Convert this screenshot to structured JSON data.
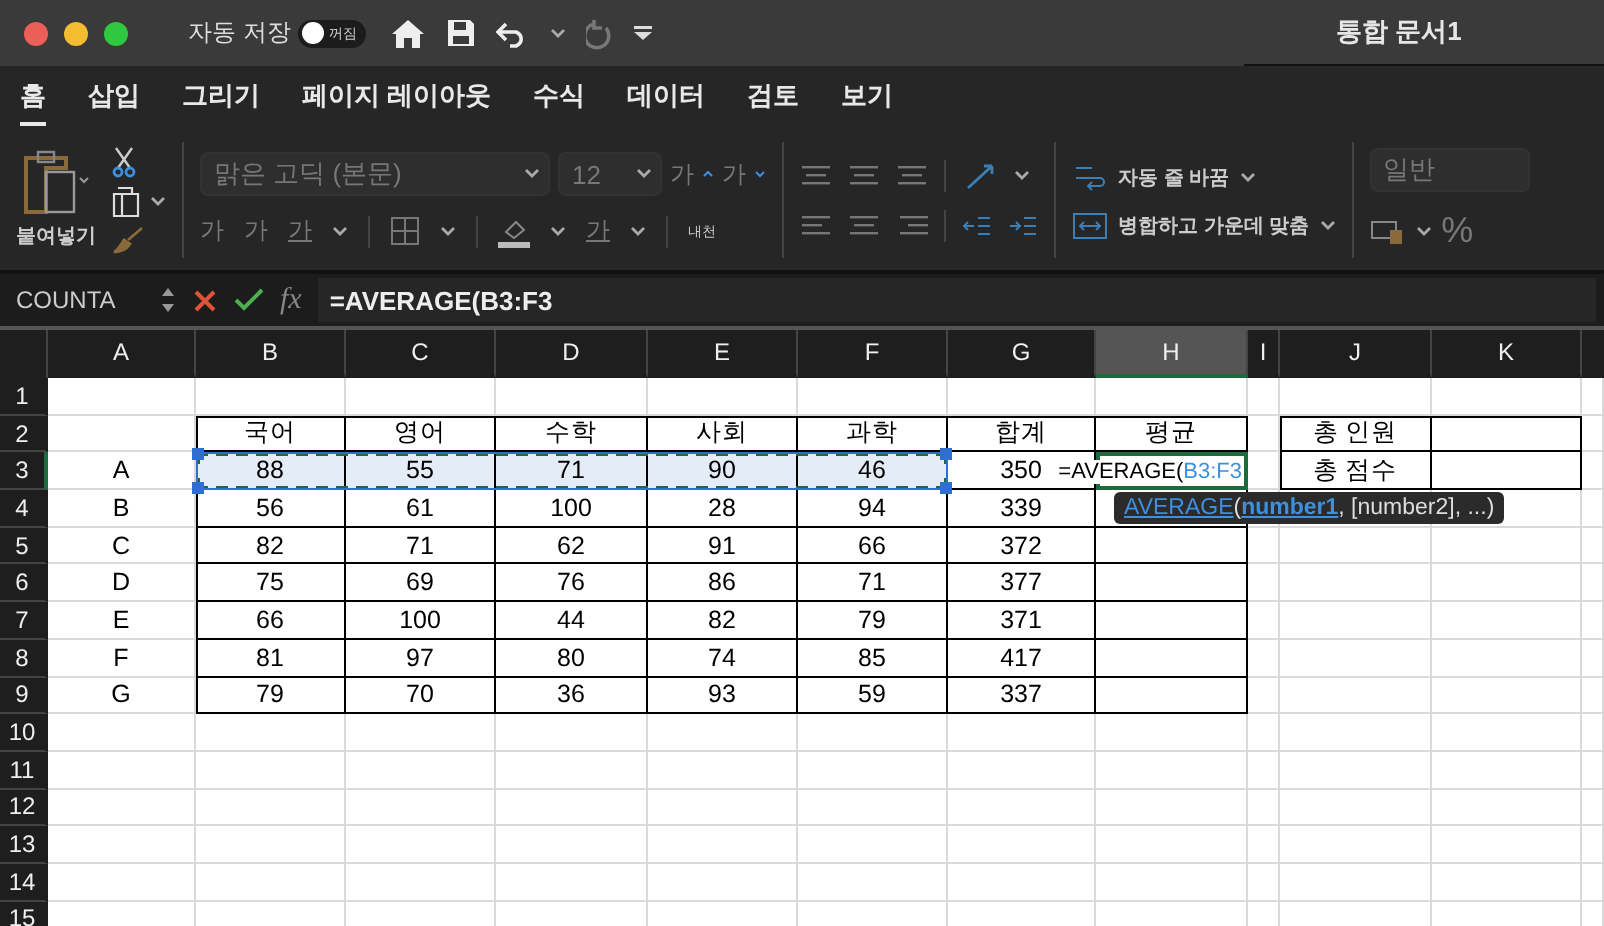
{
  "window": {
    "title": "통합 문서1"
  },
  "autosave": {
    "label": "자동 저장",
    "state_label": "꺼짐",
    "on": false
  },
  "tabs": [
    {
      "label": "홈",
      "selected": true
    },
    {
      "label": "삽입",
      "selected": false
    },
    {
      "label": "그리기",
      "selected": false
    },
    {
      "label": "페이지 레이아웃",
      "selected": false
    },
    {
      "label": "수식",
      "selected": false
    },
    {
      "label": "데이터",
      "selected": false
    },
    {
      "label": "검토",
      "selected": false
    },
    {
      "label": "보기",
      "selected": false
    }
  ],
  "ribbon": {
    "paste_label": "붙여넣기",
    "font_name": "맑은 고딕 (본문)",
    "font_size": "12",
    "grow_font": "가",
    "shrink_font": "가",
    "style_buttons": [
      "가",
      "가",
      "가"
    ],
    "font_color": "가",
    "phonetic": "내천",
    "wrap_text": "자동 줄 바꿈",
    "merge_center": "병합하고 가운데 맞춤",
    "number_format": "일반",
    "percent": "%"
  },
  "formula_bar": {
    "name_box": "COUNTA",
    "fx": "fx",
    "formula": "=AVERAGE(B3:F3"
  },
  "columns": [
    "A",
    "B",
    "C",
    "D",
    "E",
    "F",
    "G",
    "H",
    "I",
    "J",
    "K"
  ],
  "rows": [
    {
      "number": "1",
      "cells": [
        {
          "bordered": false
        },
        {
          "bordered": false
        },
        {
          "bordered": false
        },
        {
          "bordered": false
        },
        {
          "bordered": false
        },
        {
          "bordered": false
        },
        {
          "bordered": false
        },
        {
          "bordered": false
        },
        {
          "bordered": false
        },
        {
          "bordered": false
        },
        {
          "bordered": false
        }
      ]
    },
    {
      "number": "2",
      "cells": [
        {
          "bordered": false
        },
        {
          "text": "국어",
          "bordered": true
        },
        {
          "text": "영어",
          "bordered": true
        },
        {
          "text": "수학",
          "bordered": true
        },
        {
          "text": "사회",
          "bordered": true
        },
        {
          "text": "과학",
          "bordered": true
        },
        {
          "text": "합계",
          "bordered": true
        },
        {
          "text": "평균",
          "bordered": true
        },
        {
          "bordered": false
        },
        {
          "text": "총 인원",
          "bordered": true
        },
        {
          "bordered": true
        }
      ]
    },
    {
      "number": "3",
      "cells": [
        {
          "text": "A",
          "bordered": false
        },
        {
          "text": "88",
          "bordered": true,
          "copied": true
        },
        {
          "text": "55",
          "bordered": true,
          "copied": true
        },
        {
          "text": "71",
          "bordered": true,
          "copied": true
        },
        {
          "text": "90",
          "bordered": true,
          "copied": true
        },
        {
          "text": "46",
          "bordered": true,
          "copied": true
        },
        {
          "text": "350",
          "bordered": true
        },
        {
          "bordered": true,
          "active": true,
          "parts": [
            {
              "kind": "plain",
              "text": "=AVERAGE("
            },
            {
              "kind": "reference",
              "text": "B3:F3"
            }
          ]
        },
        {
          "bordered": false
        },
        {
          "text": "총 점수",
          "bordered": true
        },
        {
          "bordered": true
        }
      ]
    },
    {
      "number": "4",
      "cells": [
        {
          "text": "B",
          "bordered": false
        },
        {
          "text": "56",
          "bordered": true
        },
        {
          "text": "61",
          "bordered": true
        },
        {
          "text": "100",
          "bordered": true
        },
        {
          "text": "28",
          "bordered": true
        },
        {
          "text": "94",
          "bordered": true
        },
        {
          "text": "339",
          "bordered": true
        },
        {
          "bordered": true
        },
        {
          "bordered": false
        },
        {
          "bordered": false
        },
        {
          "bordered": false
        }
      ]
    },
    {
      "number": "5",
      "cells": [
        {
          "text": "C",
          "bordered": false
        },
        {
          "text": "82",
          "bordered": true
        },
        {
          "text": "71",
          "bordered": true
        },
        {
          "text": "62",
          "bordered": true
        },
        {
          "text": "91",
          "bordered": true
        },
        {
          "text": "66",
          "bordered": true
        },
        {
          "text": "372",
          "bordered": true
        },
        {
          "bordered": true
        },
        {
          "bordered": false
        },
        {
          "bordered": false
        },
        {
          "bordered": false
        }
      ]
    },
    {
      "number": "6",
      "cells": [
        {
          "text": "D",
          "bordered": false
        },
        {
          "text": "75",
          "bordered": true
        },
        {
          "text": "69",
          "bordered": true
        },
        {
          "text": "76",
          "bordered": true
        },
        {
          "text": "86",
          "bordered": true
        },
        {
          "text": "71",
          "bordered": true
        },
        {
          "text": "377",
          "bordered": true
        },
        {
          "bordered": true
        },
        {
          "bordered": false
        },
        {
          "bordered": false
        },
        {
          "bordered": false
        }
      ]
    },
    {
      "number": "7",
      "cells": [
        {
          "text": "E",
          "bordered": false
        },
        {
          "text": "66",
          "bordered": true
        },
        {
          "text": "100",
          "bordered": true
        },
        {
          "text": "44",
          "bordered": true
        },
        {
          "text": "82",
          "bordered": true
        },
        {
          "text": "79",
          "bordered": true
        },
        {
          "text": "371",
          "bordered": true
        },
        {
          "bordered": true
        },
        {
          "bordered": false
        },
        {
          "bordered": false
        },
        {
          "bordered": false
        }
      ]
    },
    {
      "number": "8",
      "cells": [
        {
          "text": "F",
          "bordered": false
        },
        {
          "text": "81",
          "bordered": true
        },
        {
          "text": "97",
          "bordered": true
        },
        {
          "text": "80",
          "bordered": true
        },
        {
          "text": "74",
          "bordered": true
        },
        {
          "text": "85",
          "bordered": true
        },
        {
          "text": "417",
          "bordered": true
        },
        {
          "bordered": true
        },
        {
          "bordered": false
        },
        {
          "bordered": false
        },
        {
          "bordered": false
        }
      ]
    },
    {
      "number": "9",
      "cells": [
        {
          "text": "G",
          "bordered": false
        },
        {
          "text": "79",
          "bordered": true
        },
        {
          "text": "70",
          "bordered": true
        },
        {
          "text": "36",
          "bordered": true
        },
        {
          "text": "93",
          "bordered": true
        },
        {
          "text": "59",
          "bordered": true
        },
        {
          "text": "337",
          "bordered": true
        },
        {
          "bordered": true
        },
        {
          "bordered": false
        },
        {
          "bordered": false
        },
        {
          "bordered": false
        }
      ]
    },
    {
      "number": "10"
    },
    {
      "number": "11"
    },
    {
      "number": "12"
    },
    {
      "number": "13"
    },
    {
      "number": "14"
    },
    {
      "number": "15"
    }
  ],
  "tooltip": {
    "parts": [
      {
        "kind": "function",
        "text": "AVERAGE"
      },
      {
        "kind": "plain",
        "text": "("
      },
      {
        "kind": "current",
        "text": "number1"
      },
      {
        "kind": "plain",
        "text": ", [number2], ...)"
      }
    ]
  }
}
